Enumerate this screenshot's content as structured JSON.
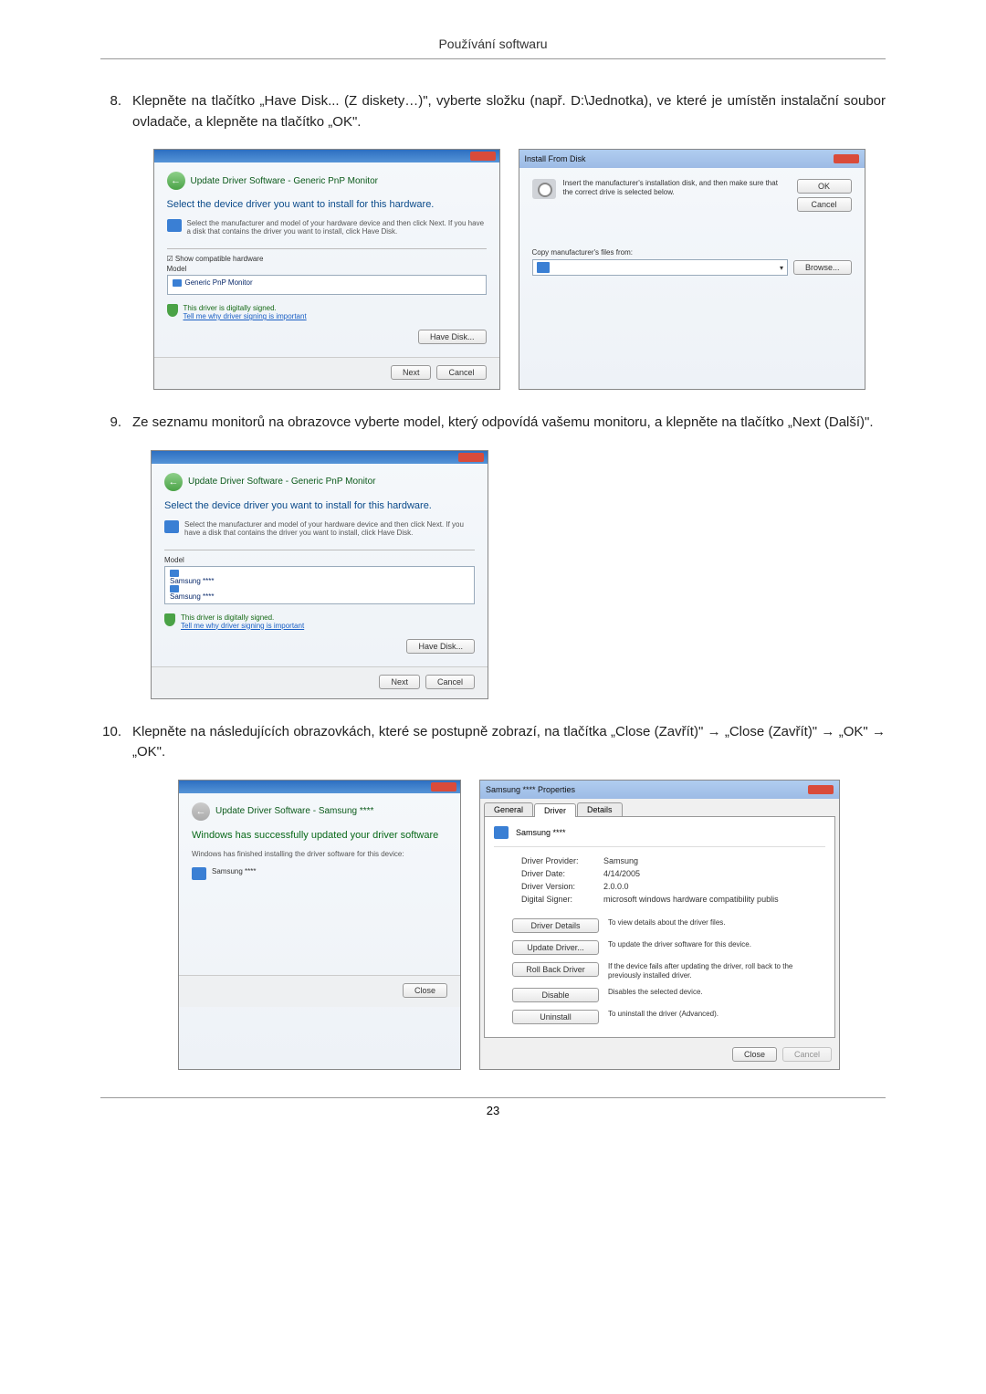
{
  "page_header": "Používání softwaru",
  "steps": {
    "8": {
      "num": "8.",
      "text": "Klepněte na tlačítko „Have Disk... (Z diskety…)\", vyberte složku (např. D:\\Jednotka), ve které je umístěn instalační soubor ovladače, a klepněte na tlačítko „OK\"."
    },
    "9": {
      "num": "9.",
      "text": "Ze seznamu monitorů na obrazovce vyberte model, který odpovídá vašemu monitoru, a klepněte na tlačítko „Next (Další)\"."
    },
    "10": {
      "num": "10.",
      "text": "Klepněte na následujících obrazovkách, které se postupně zobrazí, na tlačítka „Close (Zavřít)\" → „Close (Zavřít)\" → „OK\" → „OK\"."
    }
  },
  "dialog_driver_select": {
    "nav_title": "Update Driver Software - Generic PnP Monitor",
    "heading": "Select the device driver you want to install for this hardware.",
    "sub": "Select the manufacturer and model of your hardware device and then click Next. If you have a disk that contains the driver you want to install, click Have Disk.",
    "show_compat": "Show compatible hardware",
    "model_label": "Model",
    "model_item": "Generic PnP Monitor",
    "signed": "This driver is digitally signed.",
    "signed_link": "Tell me why driver signing is important",
    "have_disk": "Have Disk...",
    "next": "Next",
    "cancel": "Cancel"
  },
  "dialog_install_disk": {
    "title": "Install From Disk",
    "text": "Insert the manufacturer's installation disk, and then make sure that the correct drive is selected below.",
    "ok": "OK",
    "cancel": "Cancel",
    "copy_label": "Copy manufacturer's files from:",
    "browse": "Browse..."
  },
  "dialog_driver_select2": {
    "nav_title": "Update Driver Software - Generic PnP Monitor",
    "heading": "Select the device driver you want to install for this hardware.",
    "sub": "Select the manufacturer and model of your hardware device and then click Next. If you have a disk that contains the driver you want to install, click Have Disk.",
    "model_label": "Model",
    "item1": "Samsung ****",
    "item2": "Samsung ****",
    "signed": "This driver is digitally signed.",
    "signed_link": "Tell me why driver signing is important",
    "have_disk": "Have Disk...",
    "next": "Next",
    "cancel": "Cancel"
  },
  "dialog_success": {
    "nav_title": "Update Driver Software - Samsung ****",
    "heading": "Windows has successfully updated your driver software",
    "sub": "Windows has finished installing the driver software for this device:",
    "device": "Samsung ****",
    "close": "Close"
  },
  "dialog_props": {
    "title": "Samsung **** Properties",
    "tab_general": "General",
    "tab_driver": "Driver",
    "tab_details": "Details",
    "device": "Samsung ****",
    "provider_k": "Driver Provider:",
    "provider_v": "Samsung",
    "date_k": "Driver Date:",
    "date_v": "4/14/2005",
    "version_k": "Driver Version:",
    "version_v": "2.0.0.0",
    "signer_k": "Digital Signer:",
    "signer_v": "microsoft windows hardware compatibility publis",
    "btn_details": "Driver Details",
    "btn_details_d": "To view details about the driver files.",
    "btn_update": "Update Driver...",
    "btn_update_d": "To update the driver software for this device.",
    "btn_rollback": "Roll Back Driver",
    "btn_rollback_d": "If the device fails after updating the driver, roll back to the previously installed driver.",
    "btn_disable": "Disable",
    "btn_disable_d": "Disables the selected device.",
    "btn_uninstall": "Uninstall",
    "btn_uninstall_d": "To uninstall the driver (Advanced).",
    "close": "Close",
    "cancel": "Cancel"
  },
  "page_num": "23"
}
